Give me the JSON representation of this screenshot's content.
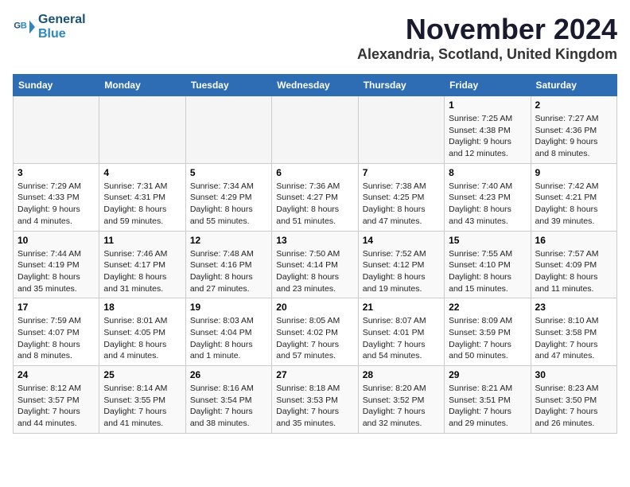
{
  "logo": {
    "line1": "General",
    "line2": "Blue"
  },
  "title": "November 2024",
  "location": "Alexandria, Scotland, United Kingdom",
  "headers": [
    "Sunday",
    "Monday",
    "Tuesday",
    "Wednesday",
    "Thursday",
    "Friday",
    "Saturday"
  ],
  "weeks": [
    [
      {
        "day": "",
        "info": ""
      },
      {
        "day": "",
        "info": ""
      },
      {
        "day": "",
        "info": ""
      },
      {
        "day": "",
        "info": ""
      },
      {
        "day": "",
        "info": ""
      },
      {
        "day": "1",
        "info": "Sunrise: 7:25 AM\nSunset: 4:38 PM\nDaylight: 9 hours\nand 12 minutes."
      },
      {
        "day": "2",
        "info": "Sunrise: 7:27 AM\nSunset: 4:36 PM\nDaylight: 9 hours\nand 8 minutes."
      }
    ],
    [
      {
        "day": "3",
        "info": "Sunrise: 7:29 AM\nSunset: 4:33 PM\nDaylight: 9 hours\nand 4 minutes."
      },
      {
        "day": "4",
        "info": "Sunrise: 7:31 AM\nSunset: 4:31 PM\nDaylight: 8 hours\nand 59 minutes."
      },
      {
        "day": "5",
        "info": "Sunrise: 7:34 AM\nSunset: 4:29 PM\nDaylight: 8 hours\nand 55 minutes."
      },
      {
        "day": "6",
        "info": "Sunrise: 7:36 AM\nSunset: 4:27 PM\nDaylight: 8 hours\nand 51 minutes."
      },
      {
        "day": "7",
        "info": "Sunrise: 7:38 AM\nSunset: 4:25 PM\nDaylight: 8 hours\nand 47 minutes."
      },
      {
        "day": "8",
        "info": "Sunrise: 7:40 AM\nSunset: 4:23 PM\nDaylight: 8 hours\nand 43 minutes."
      },
      {
        "day": "9",
        "info": "Sunrise: 7:42 AM\nSunset: 4:21 PM\nDaylight: 8 hours\nand 39 minutes."
      }
    ],
    [
      {
        "day": "10",
        "info": "Sunrise: 7:44 AM\nSunset: 4:19 PM\nDaylight: 8 hours\nand 35 minutes."
      },
      {
        "day": "11",
        "info": "Sunrise: 7:46 AM\nSunset: 4:17 PM\nDaylight: 8 hours\nand 31 minutes."
      },
      {
        "day": "12",
        "info": "Sunrise: 7:48 AM\nSunset: 4:16 PM\nDaylight: 8 hours\nand 27 minutes."
      },
      {
        "day": "13",
        "info": "Sunrise: 7:50 AM\nSunset: 4:14 PM\nDaylight: 8 hours\nand 23 minutes."
      },
      {
        "day": "14",
        "info": "Sunrise: 7:52 AM\nSunset: 4:12 PM\nDaylight: 8 hours\nand 19 minutes."
      },
      {
        "day": "15",
        "info": "Sunrise: 7:55 AM\nSunset: 4:10 PM\nDaylight: 8 hours\nand 15 minutes."
      },
      {
        "day": "16",
        "info": "Sunrise: 7:57 AM\nSunset: 4:09 PM\nDaylight: 8 hours\nand 11 minutes."
      }
    ],
    [
      {
        "day": "17",
        "info": "Sunrise: 7:59 AM\nSunset: 4:07 PM\nDaylight: 8 hours\nand 8 minutes."
      },
      {
        "day": "18",
        "info": "Sunrise: 8:01 AM\nSunset: 4:05 PM\nDaylight: 8 hours\nand 4 minutes."
      },
      {
        "day": "19",
        "info": "Sunrise: 8:03 AM\nSunset: 4:04 PM\nDaylight: 8 hours\nand 1 minute."
      },
      {
        "day": "20",
        "info": "Sunrise: 8:05 AM\nSunset: 4:02 PM\nDaylight: 7 hours\nand 57 minutes."
      },
      {
        "day": "21",
        "info": "Sunrise: 8:07 AM\nSunset: 4:01 PM\nDaylight: 7 hours\nand 54 minutes."
      },
      {
        "day": "22",
        "info": "Sunrise: 8:09 AM\nSunset: 3:59 PM\nDaylight: 7 hours\nand 50 minutes."
      },
      {
        "day": "23",
        "info": "Sunrise: 8:10 AM\nSunset: 3:58 PM\nDaylight: 7 hours\nand 47 minutes."
      }
    ],
    [
      {
        "day": "24",
        "info": "Sunrise: 8:12 AM\nSunset: 3:57 PM\nDaylight: 7 hours\nand 44 minutes."
      },
      {
        "day": "25",
        "info": "Sunrise: 8:14 AM\nSunset: 3:55 PM\nDaylight: 7 hours\nand 41 minutes."
      },
      {
        "day": "26",
        "info": "Sunrise: 8:16 AM\nSunset: 3:54 PM\nDaylight: 7 hours\nand 38 minutes."
      },
      {
        "day": "27",
        "info": "Sunrise: 8:18 AM\nSunset: 3:53 PM\nDaylight: 7 hours\nand 35 minutes."
      },
      {
        "day": "28",
        "info": "Sunrise: 8:20 AM\nSunset: 3:52 PM\nDaylight: 7 hours\nand 32 minutes."
      },
      {
        "day": "29",
        "info": "Sunrise: 8:21 AM\nSunset: 3:51 PM\nDaylight: 7 hours\nand 29 minutes."
      },
      {
        "day": "30",
        "info": "Sunrise: 8:23 AM\nSunset: 3:50 PM\nDaylight: 7 hours\nand 26 minutes."
      }
    ]
  ]
}
